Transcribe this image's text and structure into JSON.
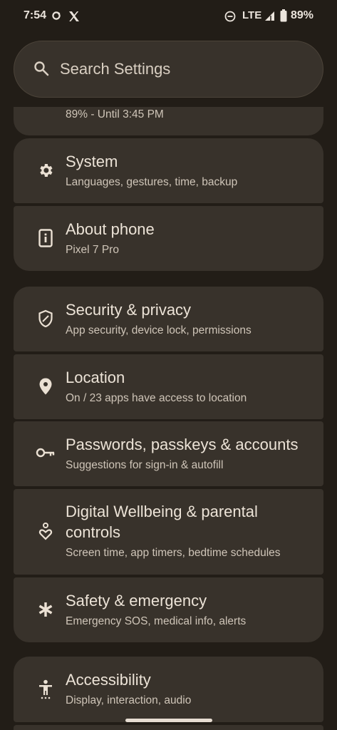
{
  "status_bar": {
    "time": "7:54",
    "network": "LTE",
    "battery": "89%"
  },
  "search": {
    "placeholder": "Search Settings"
  },
  "items": [
    {
      "title": "",
      "subtitle": "89% - Until 3:45 PM",
      "icon": "battery-icon"
    },
    {
      "title": "System",
      "subtitle": "Languages, gestures, time, backup",
      "icon": "gear-icon"
    },
    {
      "title": "About phone",
      "subtitle": "Pixel 7 Pro",
      "icon": "phone-info-icon"
    },
    {
      "title": "Security & privacy",
      "subtitle": "App security, device lock, permissions",
      "icon": "shield-icon"
    },
    {
      "title": "Location",
      "subtitle": "On / 23 apps have access to location",
      "icon": "location-pin-icon"
    },
    {
      "title": "Passwords, passkeys & accounts",
      "subtitle": "Suggestions for sign-in & autofill",
      "icon": "key-icon"
    },
    {
      "title": "Digital Wellbeing & parental controls",
      "subtitle": "Screen time, app timers, bedtime schedules",
      "icon": "wellbeing-heart-icon"
    },
    {
      "title": "Safety & emergency",
      "subtitle": "Emergency SOS, medical info, alerts",
      "icon": "asterisk-icon"
    },
    {
      "title": "Accessibility",
      "subtitle": "Display, interaction, audio",
      "icon": "accessibility-icon"
    }
  ],
  "colors": {
    "background": "#221d17",
    "card": "#38322b",
    "title_text": "#ece3d7",
    "subtitle_text": "#cfc5b8"
  }
}
